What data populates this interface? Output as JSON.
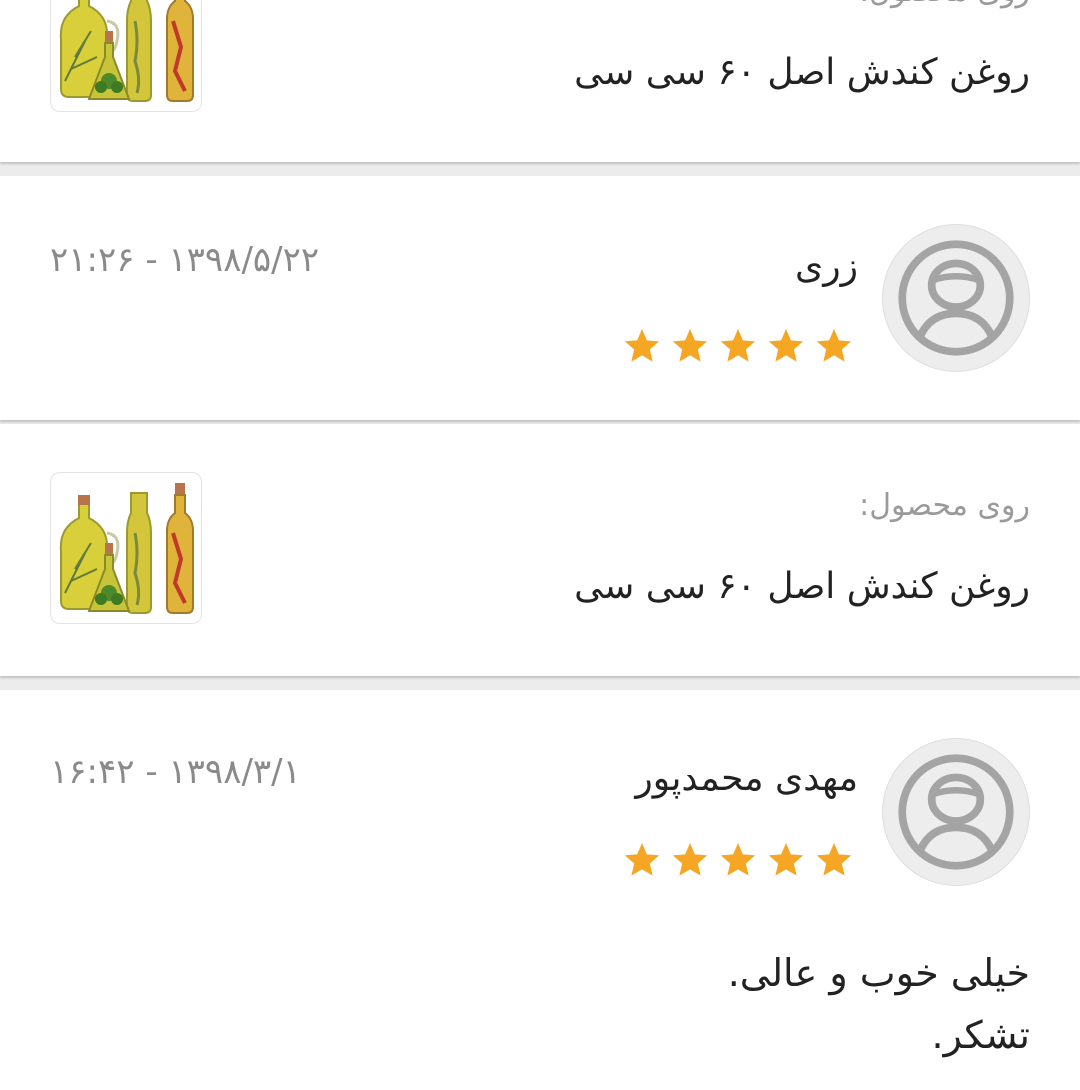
{
  "accent_colors": {
    "star": "#f5a623",
    "avatar_stroke": "#a4a4a4"
  },
  "cards": [
    {
      "type": "product",
      "label": "روی محصول:",
      "product_name": "روغن کندش اصل ۶۰ سی سی",
      "image_icon": "oil-bottles-image"
    },
    {
      "type": "review",
      "author": "زری",
      "datetime": "۱۳۹۸/۵/۲۲ - ۲۱:۲۶",
      "rating": 5,
      "avatar_icon": "user-avatar-icon"
    },
    {
      "type": "product",
      "label": "روی محصول:",
      "product_name": "روغن کندش اصل ۶۰ سی سی",
      "image_icon": "oil-bottles-image"
    },
    {
      "type": "review",
      "author": "مهدی محمدپور",
      "datetime": "۱۳۹۸/۳/۱ - ۱۶:۴۲",
      "rating": 5,
      "avatar_icon": "user-avatar-icon",
      "comment_lines": [
        "خیلی خوب و عالی.",
        "تشکر."
      ]
    }
  ]
}
